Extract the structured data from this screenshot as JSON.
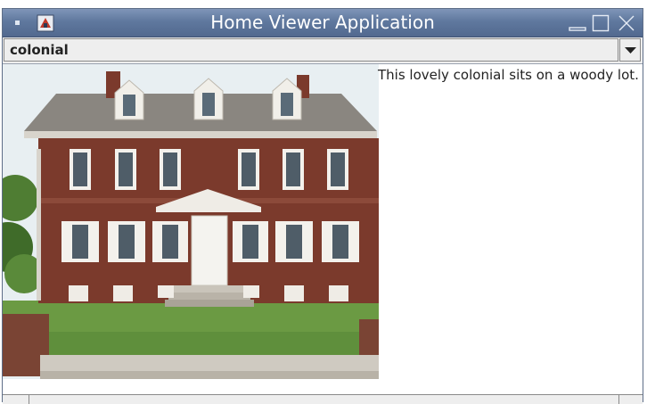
{
  "window": {
    "title": "Home Viewer Application"
  },
  "icons": {
    "system_menu": "system-menu-icon",
    "app": "app-icon",
    "minimize": "minimize-icon",
    "maximize": "maximize-icon",
    "close": "close-icon",
    "dropdown": "chevron-down-icon"
  },
  "selector": {
    "selected": "colonial"
  },
  "listing": {
    "description": "This lovely colonial sits on a woody lot."
  },
  "colors": {
    "titlebar": "#5f789e",
    "brick": "#7b3a2c",
    "lawn": "#5f8f3c"
  }
}
